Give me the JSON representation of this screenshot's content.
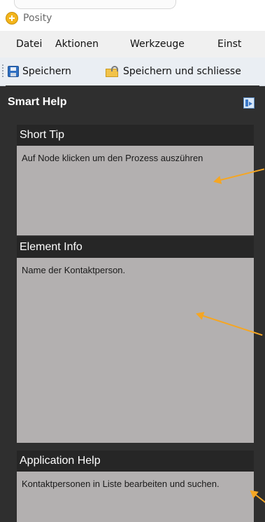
{
  "window": {
    "title": "Posity"
  },
  "menu": {
    "items": [
      "Datei",
      "Aktionen",
      "Werkzeuge",
      "Einst"
    ]
  },
  "toolbar": {
    "save_label": "Speichern",
    "save_close_label": "Speichern und schliesse"
  },
  "smart_help": {
    "title": "Smart Help",
    "short_tip": {
      "header": "Short Tip",
      "text": "Auf Node klicken um den Prozess auszühren"
    },
    "element_info": {
      "header": "Element Info",
      "text": "Name der Kontaktperson."
    },
    "application_help": {
      "header": "Application Help",
      "text": "Kontaktpersonen in Liste bearbeiten und suchen."
    }
  },
  "icons": {
    "app": "posity-plus-icon",
    "save": "floppy-disk-icon",
    "save_close": "folder-lock-icon",
    "panel": "dock-icon"
  },
  "colors": {
    "panel_bg": "#2f2f2f",
    "section_bg": "#b3b0b0",
    "header_bg": "#262626",
    "annotation_arrow": "#f5a623"
  }
}
